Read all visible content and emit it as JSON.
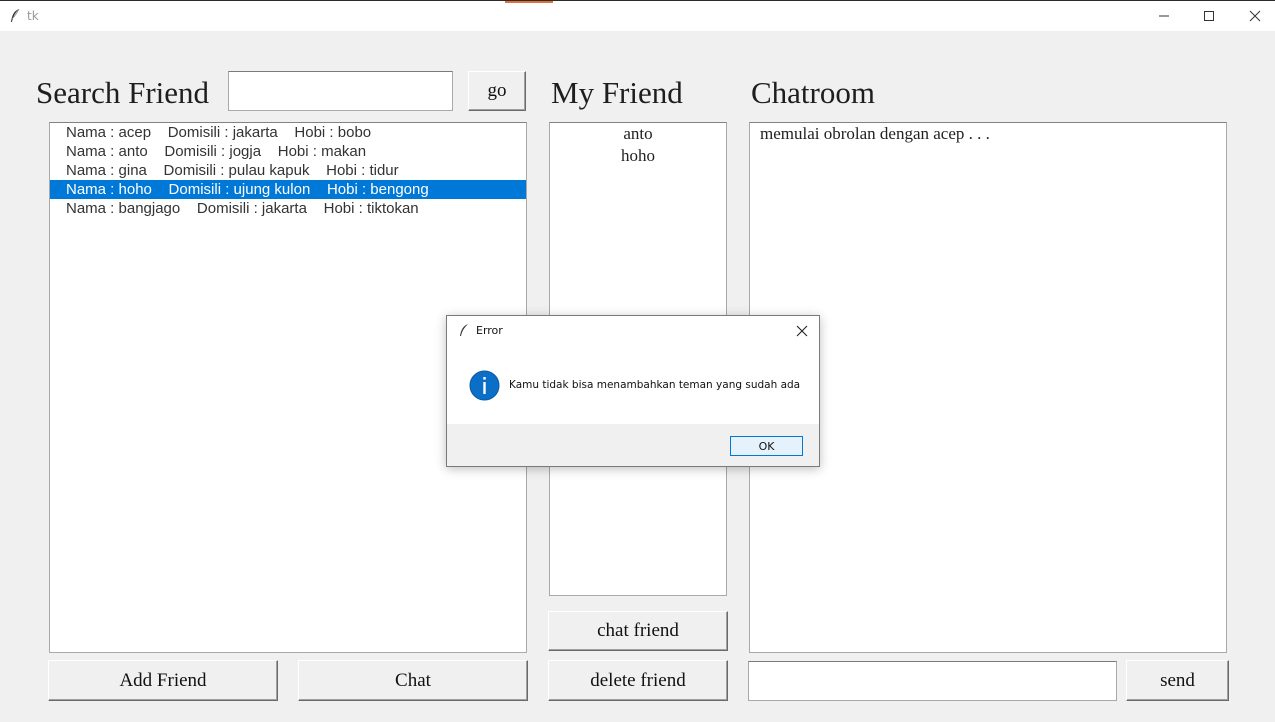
{
  "window": {
    "title": "tk"
  },
  "search": {
    "heading": "Search Friend",
    "input_value": "",
    "go_label": "go",
    "results": [
      "Nama : acep    Domisili : jakarta    Hobi : bobo",
      "Nama : anto    Domisili : jogja    Hobi : makan",
      "Nama : gina    Domisili : pulau kapuk    Hobi : tidur",
      "Nama : hoho    Domisili : ujung kulon    Hobi : bengong",
      "Nama : bangjago    Domisili : jakarta    Hobi : tiktokan"
    ],
    "selected_index": 3,
    "add_label": "Add Friend",
    "chat_label": "Chat"
  },
  "friends": {
    "heading": "My Friend",
    "items": [
      "anto",
      "hoho"
    ],
    "chat_friend_label": "chat friend",
    "delete_friend_label": "delete friend"
  },
  "chatroom": {
    "heading": "Chatroom",
    "messages": [
      "memulai obrolan dengan acep . . ."
    ],
    "input_value": "",
    "send_label": "send"
  },
  "dialog": {
    "title": "Error",
    "icon": "info-icon",
    "message": "Kamu tidak bisa menambahkan teman yang sudah ada",
    "ok_label": "OK"
  },
  "colors": {
    "selection": "#0078d7",
    "window_bg": "#f0f0f0",
    "titlebar_accent": "#e0703a"
  }
}
